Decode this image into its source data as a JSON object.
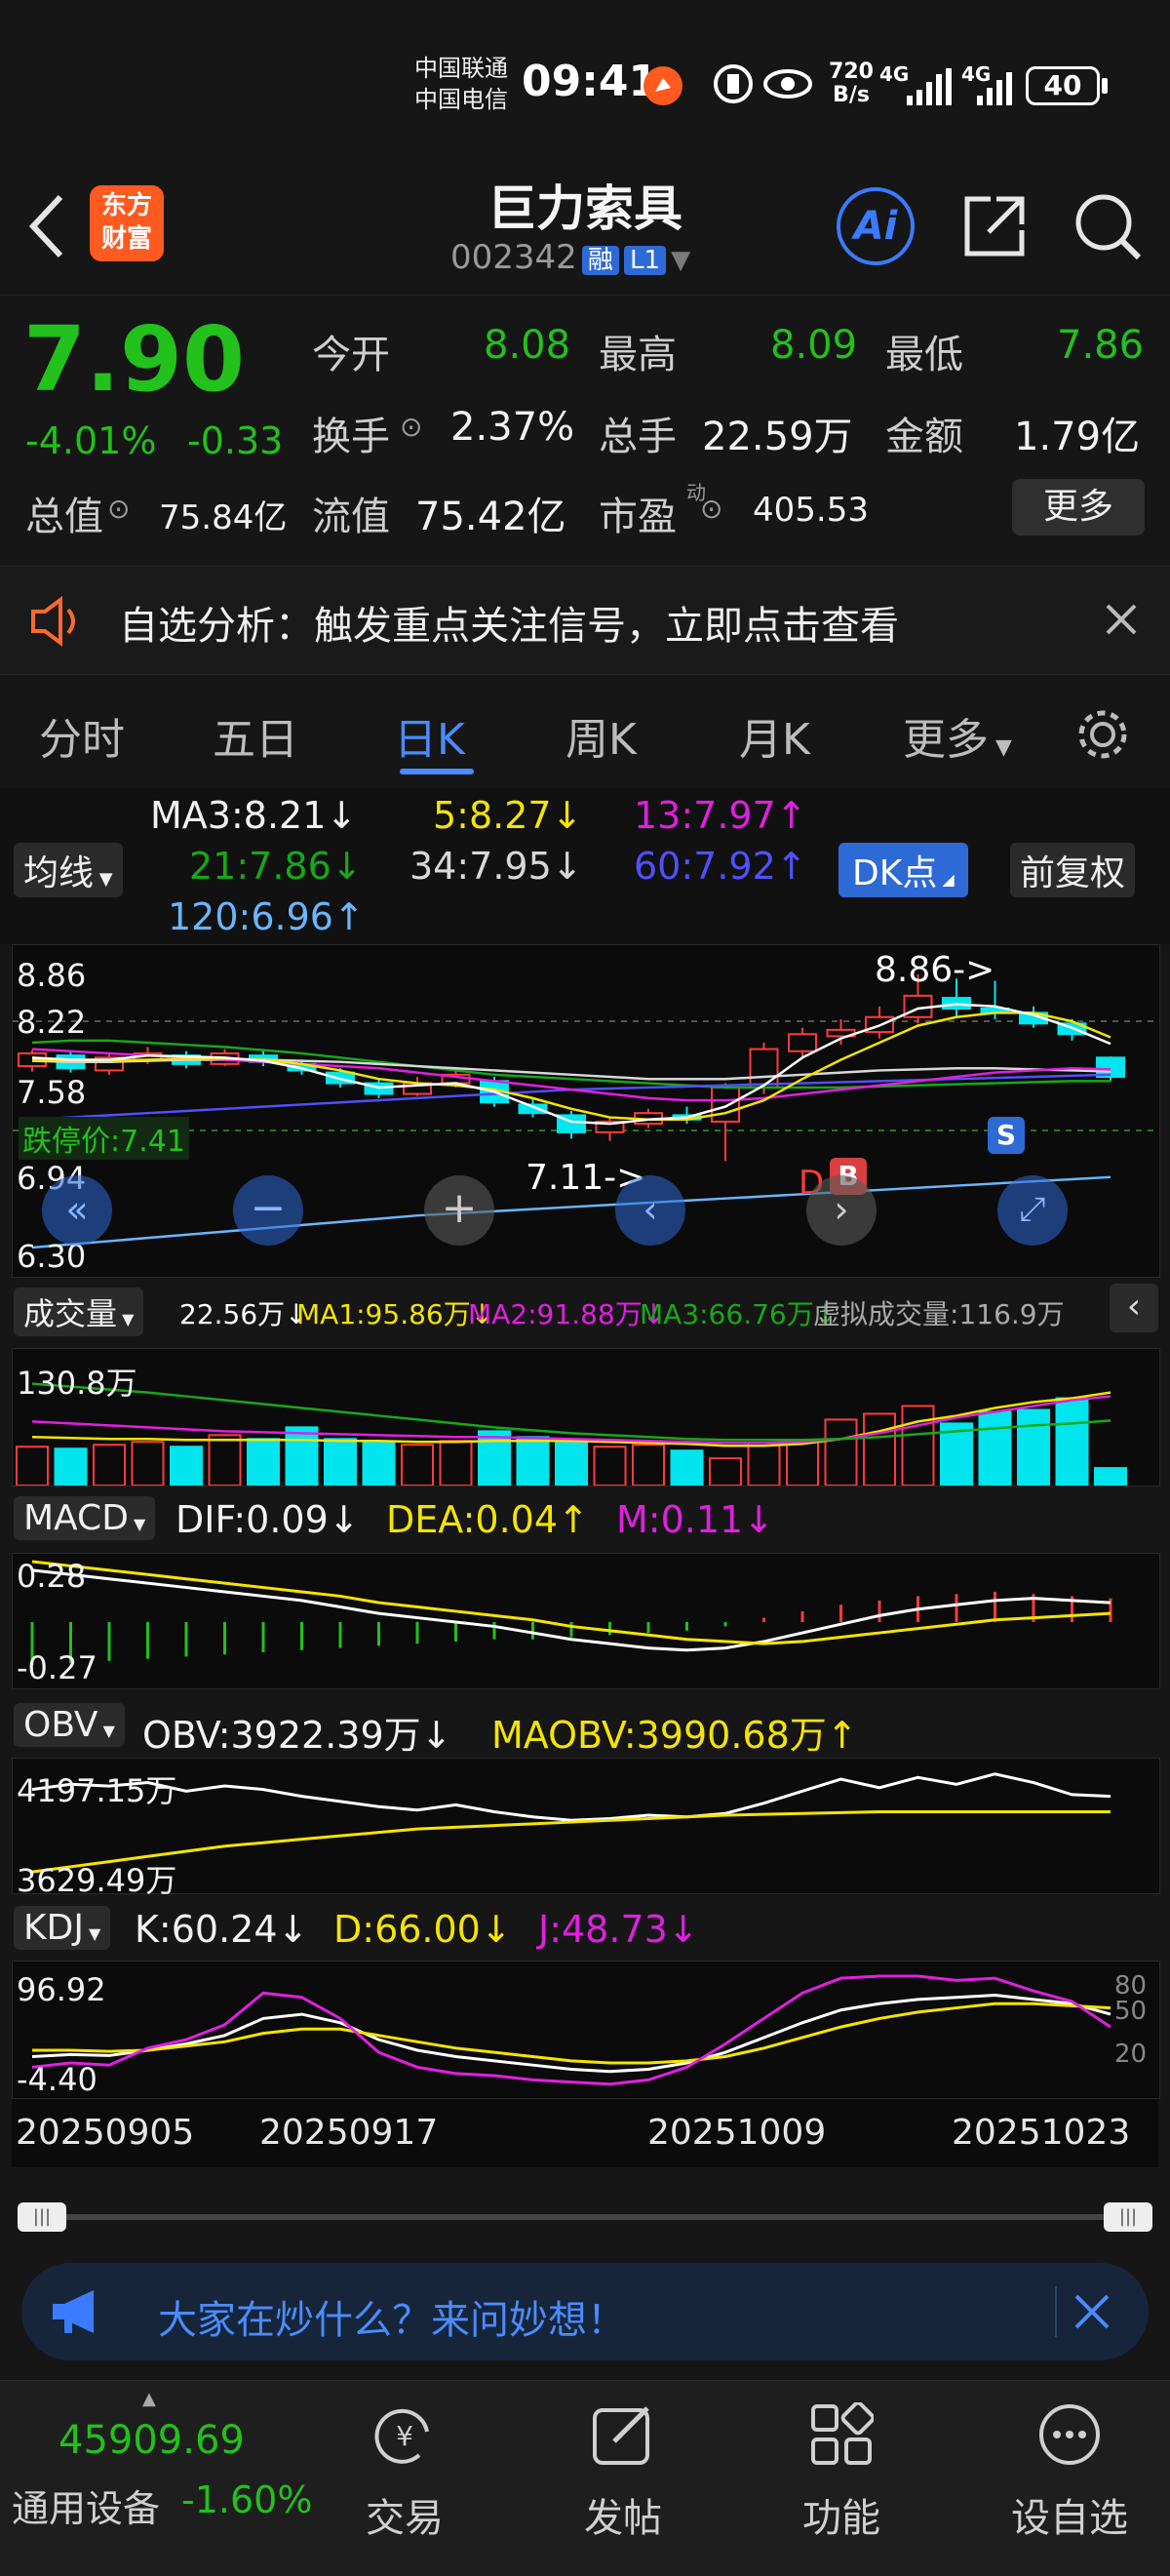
{
  "status_bar": {
    "carrier1": "中国联通",
    "carrier2": "中国电信",
    "time": "09:41",
    "net_speed_top": "720",
    "net_speed_bottom": "B/s",
    "sig1": "4G",
    "sig2": "4G",
    "battery": "40"
  },
  "header": {
    "logo_line1": "东方",
    "logo_line2": "财富",
    "title": "巨力索具",
    "code": "002342",
    "tag1": "融",
    "tag2": "L1",
    "ai_label": "Ai"
  },
  "quote": {
    "price": "7.90",
    "change_pct": "-4.01%",
    "change": "-0.33",
    "open_label": "今开",
    "open": "8.08",
    "high_label": "最高",
    "high": "8.09",
    "low_label": "最低",
    "low": "7.86",
    "turnover_label": "换手",
    "turnover": "2.37%",
    "volume_label": "总手",
    "volume": "22.59万",
    "amount_label": "金额",
    "amount": "1.79亿",
    "mktcap_label": "总值",
    "mktcap": "75.84亿",
    "float_label": "流值",
    "float": "75.42亿",
    "pe_label": "市盈",
    "pe_sup": "动",
    "pe": "405.53",
    "more_label": "更多"
  },
  "notice": {
    "text": "自选分析：触发重点关注信号，立即点击查看"
  },
  "tabs": [
    "分时",
    "五日",
    "日K",
    "周K",
    "月K",
    "更多"
  ],
  "active_tab": "日K",
  "ma_panel": {
    "chip": "均线",
    "ma3": "MA3:8.21↓",
    "ma5": "5:8.27↓",
    "ma13": "13:7.97↑",
    "ma21": "21:7.86↓",
    "ma34": "34:7.95↓",
    "ma60": "60:7.92↑",
    "ma120": "120:6.96↑",
    "dk_label": "DK点",
    "fq_label": "前复权"
  },
  "price_chart": {
    "y_labels": [
      "8.86",
      "8.22",
      "7.58",
      "6.94",
      "6.30"
    ],
    "limit_down_label": "跌停价:7.41",
    "high_annotation": "8.86->",
    "low_annotation": "7.11->",
    "d_mark": "D",
    "b_mark": "B",
    "s_mark": "S"
  },
  "volume_panel": {
    "chip": "成交量",
    "vol": "22.56万↓",
    "ma1": "MA1:95.86万↓",
    "ma2": "MA2:91.88万↓",
    "ma3": "MA3:66.76万↓",
    "virtual": "虚拟成交量:116.9万",
    "y_label": "130.8万"
  },
  "macd_panel": {
    "chip": "MACD",
    "dif": "DIF:0.09↓",
    "dea": "DEA:0.04↑",
    "m": "M:0.11↓",
    "y_top": "0.28",
    "y_bottom": "-0.27"
  },
  "obv_panel": {
    "chip": "OBV",
    "obv": "OBV:3922.39万↓",
    "maobv": "MAOBV:3990.68万↑",
    "y_top": "4197.15万",
    "y_bottom": "3629.49万"
  },
  "kdj_panel": {
    "chip": "KDJ",
    "k": "K:60.24↓",
    "d": "D:66.00↓",
    "j": "J:48.73↓",
    "y_top": "96.92",
    "y_bottom": "-4.40",
    "r80": "80",
    "r50": "50",
    "r20": "20"
  },
  "dates": [
    "20250905",
    "20250917",
    "20251009",
    "20251023"
  ],
  "ai_bar": {
    "text": "大家在炒什么？来问妙想！"
  },
  "bottom_nav": {
    "index_value": "45909.69",
    "index_name": "通用设备",
    "index_change": "-1.60%",
    "items": [
      "交易",
      "发帖",
      "功能",
      "设自选"
    ]
  },
  "colors": {
    "up": "#ff3b3b",
    "down": "#22c11b",
    "accent": "#4a8cff",
    "ma3": "#ffffff",
    "ma5": "#f5e400",
    "ma13": "#e020e0",
    "ma21": "#18a818",
    "ma60": "#5050ff",
    "ma120": "#6ab6ff",
    "candle_down": "#00e5ee"
  }
}
